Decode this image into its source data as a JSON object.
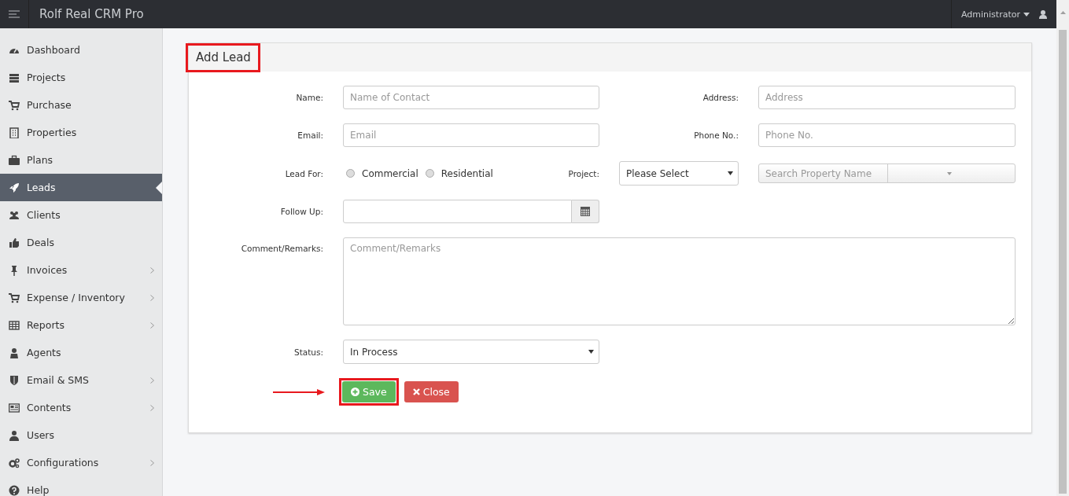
{
  "app": {
    "title": "Rolf Real CRM Pro",
    "user": "Administrator"
  },
  "sidebar": {
    "items": [
      {
        "label": "Dashboard",
        "selected": false,
        "has_submenu": false
      },
      {
        "label": "Projects",
        "selected": false,
        "has_submenu": false
      },
      {
        "label": "Purchase",
        "selected": false,
        "has_submenu": false
      },
      {
        "label": "Properties",
        "selected": false,
        "has_submenu": false
      },
      {
        "label": "Plans",
        "selected": false,
        "has_submenu": false
      },
      {
        "label": "Leads",
        "selected": true,
        "has_submenu": false
      },
      {
        "label": "Clients",
        "selected": false,
        "has_submenu": false
      },
      {
        "label": "Deals",
        "selected": false,
        "has_submenu": false
      },
      {
        "label": "Invoices",
        "selected": false,
        "has_submenu": true
      },
      {
        "label": "Expense / Inventory",
        "selected": false,
        "has_submenu": true
      },
      {
        "label": "Reports",
        "selected": false,
        "has_submenu": true
      },
      {
        "label": "Agents",
        "selected": false,
        "has_submenu": false
      },
      {
        "label": "Email & SMS",
        "selected": false,
        "has_submenu": true
      },
      {
        "label": "Contents",
        "selected": false,
        "has_submenu": true
      },
      {
        "label": "Users",
        "selected": false,
        "has_submenu": false
      },
      {
        "label": "Configurations",
        "selected": false,
        "has_submenu": true
      },
      {
        "label": "Help",
        "selected": false,
        "has_submenu": false
      }
    ]
  },
  "form": {
    "title": "Add Lead",
    "title_highlighted": true,
    "name": {
      "label": "Name:",
      "placeholder": "Name of Contact"
    },
    "address": {
      "label": "Address:",
      "placeholder": "Address"
    },
    "email": {
      "label": "Email:",
      "placeholder": "Email"
    },
    "phone": {
      "label": "Phone No.:",
      "placeholder": "Phone No."
    },
    "lead_for": {
      "label": "Lead For:",
      "options": [
        {
          "label": "Commercial",
          "selected": false
        },
        {
          "label": "Residential",
          "selected": false
        }
      ]
    },
    "project": {
      "label": "Project:",
      "value": "Please Select"
    },
    "property_search": {
      "placeholder": "Search Property Name"
    },
    "follow_up": {
      "label": "Follow Up:"
    },
    "comments": {
      "label": "Comment/Remarks:",
      "placeholder": "Comment/Remarks"
    },
    "status": {
      "label": "Status:",
      "value": "In Process"
    },
    "buttons": [
      {
        "label": "Save",
        "kind": "save",
        "highlighted": true
      },
      {
        "label": "Close",
        "kind": "close",
        "highlighted": false
      }
    ]
  }
}
